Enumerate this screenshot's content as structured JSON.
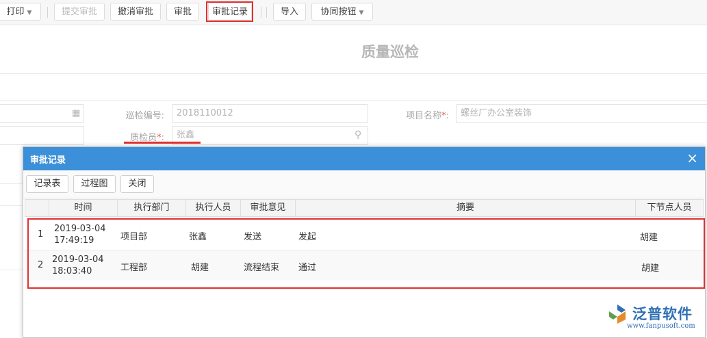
{
  "toolbar": {
    "print": "打印",
    "submit": "提交审批",
    "cancel_approval": "撤消审批",
    "approve": "审批",
    "approval_record": "审批记录",
    "import": "导入",
    "collab": "协同按钮"
  },
  "form": {
    "title": "质量巡检",
    "inspection_no_label": "巡检编号:",
    "inspection_no_value": "2018110012",
    "project_name_label": "项目名称",
    "project_name_value": "螺丝厂办公室装饰",
    "inspector_label": "质检员",
    "inspector_value": "张鑫",
    "required_mark": "*",
    "colon": ":"
  },
  "modal": {
    "title": "审批记录",
    "close": "×",
    "buttons": [
      "记录表",
      "过程图",
      "关闭"
    ],
    "columns": [
      "时间",
      "执行部门",
      "执行人员",
      "审批意见",
      "摘要",
      "下节点人员"
    ],
    "rows": [
      {
        "index": "1",
        "date": "2019-03-04",
        "time": "17:49:19",
        "dept": "项目部",
        "person": "张鑫",
        "opinion": "发送",
        "summary": "发起",
        "next": "胡建"
      },
      {
        "index": "2",
        "date": "2019-03-04",
        "time": "18:03:40",
        "dept": "工程部",
        "person": "胡建",
        "opinion": "流程结束",
        "summary": "通过",
        "next": "胡建"
      }
    ]
  },
  "watermark": {
    "brand": "泛普软件",
    "url": "www.fanpusoft.com"
  },
  "colors": {
    "accent": "#3b90d9",
    "highlight": "#e2302e"
  }
}
